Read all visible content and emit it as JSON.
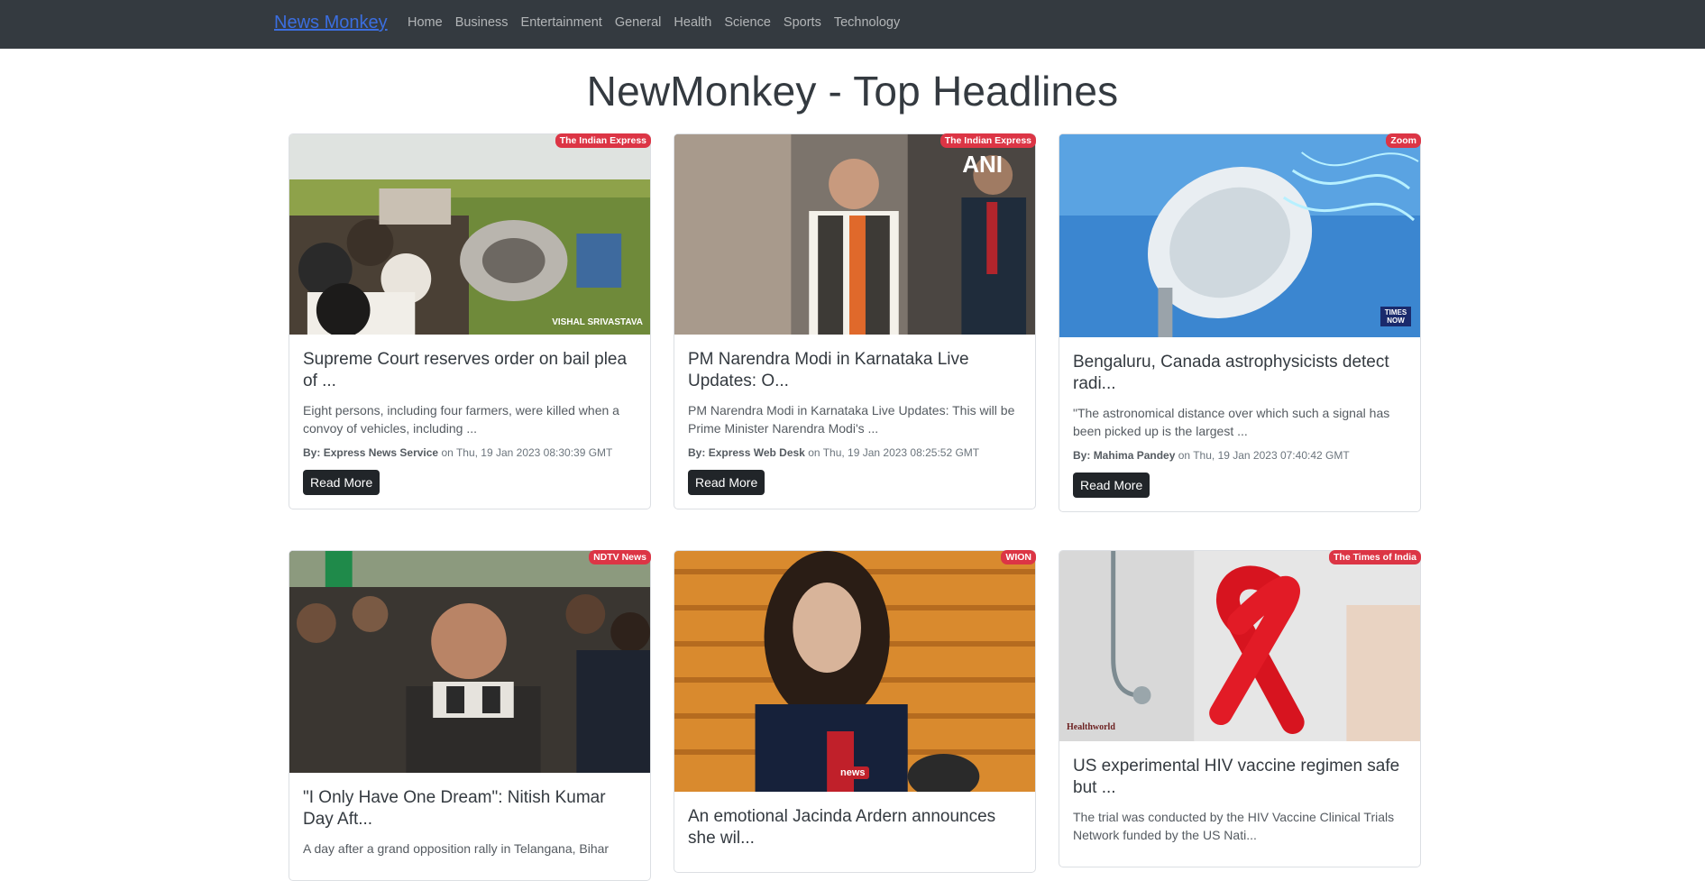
{
  "navbar": {
    "brand": "News Monkey",
    "links": [
      "Home",
      "Business",
      "Entertainment",
      "General",
      "Health",
      "Science",
      "Sports",
      "Technology"
    ]
  },
  "page_title": "NewMonkey - Top Headlines",
  "meta_prefix": "By:",
  "meta_on": "on",
  "read_more": "Read More",
  "colors": {
    "navbar_bg": "#343a40",
    "badge_bg": "#dc3545",
    "brand": "#3b6ee0"
  },
  "articles": [
    {
      "source": "The Indian Express",
      "title": "Supreme Court reserves order on bail plea of ...",
      "description": "Eight persons, including four farmers, were killed when a convoy of vehicles, including ...",
      "author": "Express News Service",
      "date": "Thu, 19 Jan 2023 08:30:39 GMT",
      "image_caption": "VISHAL SRIVASTAVA"
    },
    {
      "source": "The Indian Express",
      "title": "PM Narendra Modi in Karnataka Live Updates: O...",
      "description": "PM Narendra Modi in Karnataka Live Updates: This will be Prime Minister Narendra Modi's ...",
      "author": "Express Web Desk",
      "date": "Thu, 19 Jan 2023 08:25:52 GMT",
      "image_caption": "ANI"
    },
    {
      "source": "Zoom",
      "title": "Bengaluru, Canada astrophysicists detect radi...",
      "description": "\"The astronomical distance over which such a signal has been picked up is the largest ...",
      "author": "Mahima Pandey",
      "date": "Thu, 19 Jan 2023 07:40:42 GMT",
      "image_caption": "TIMES NOW"
    },
    {
      "source": "NDTV News",
      "title": "\"I Only Have One Dream\": Nitish Kumar Day Aft...",
      "description": "A day after a grand opposition rally in Telangana, Bihar",
      "author": "",
      "date": "",
      "image_caption": ""
    },
    {
      "source": "WION",
      "title": "An emotional Jacinda Ardern announces she wil...",
      "description": "",
      "author": "",
      "date": "",
      "image_caption": "news"
    },
    {
      "source": "The Times of India",
      "title": "US experimental HIV vaccine regimen safe but ...",
      "description": "The trial was conducted by the HIV Vaccine Clinical Trials Network funded by the US Nati...",
      "author": "",
      "date": "",
      "image_caption": "Healthworld"
    }
  ]
}
